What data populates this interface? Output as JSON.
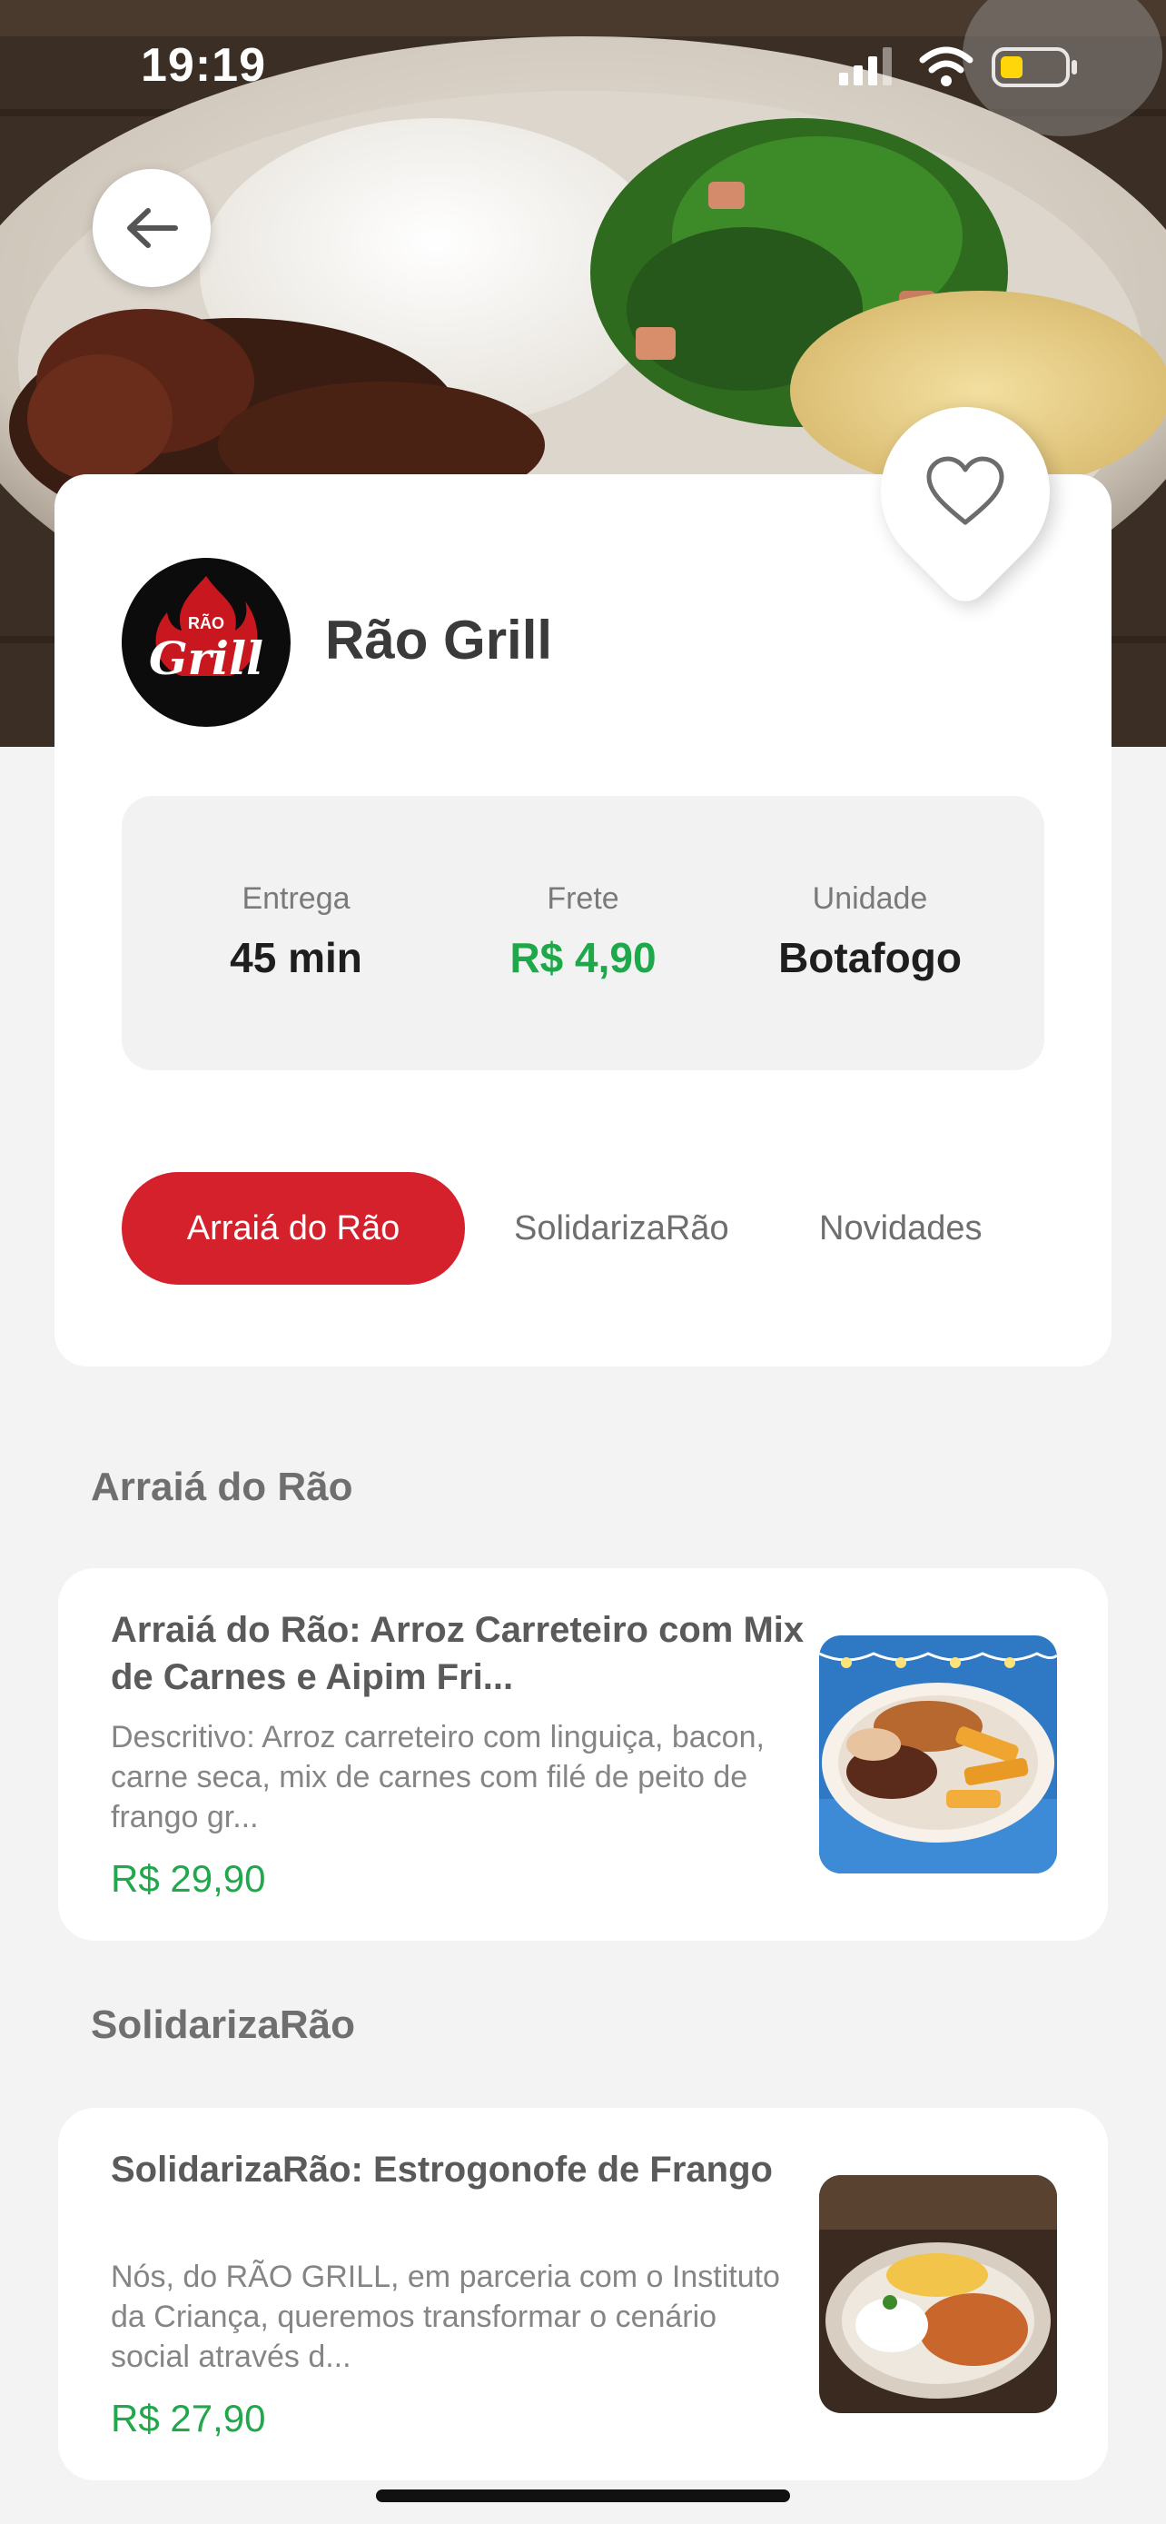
{
  "status_bar": {
    "time": "19:19"
  },
  "store": {
    "name": "Rão Grill",
    "logo_text_top": "RÃO",
    "logo_text_main": "Grill"
  },
  "info": {
    "delivery_label": "Entrega",
    "delivery_value": "45 min",
    "fee_label": "Frete",
    "fee_value": "R$ 4,90",
    "unit_label": "Unidade",
    "unit_value": "Botafogo"
  },
  "tabs": [
    {
      "label": "Arraiá do Rão",
      "active": true
    },
    {
      "label": "SolidarizaRão",
      "active": false
    },
    {
      "label": "Novidades",
      "active": false
    }
  ],
  "sections": [
    {
      "title": "Arraiá do Rão",
      "products": [
        {
          "name": "Arraiá do Rão: Arroz Carreteiro com Mix de Carnes e Aipim Fri...",
          "description": "Descritivo: Arroz carreteiro com linguiça, bacon, carne seca, mix de carnes com filé de peito de frango gr...",
          "price": "R$ 29,90"
        }
      ]
    },
    {
      "title": "SolidarizaRão",
      "products": [
        {
          "name": "SolidarizaRão: Estrogonofe de Frango",
          "description": "Nós, do RÃO GRILL, em parceria com o Instituto da Criança, queremos transformar o cenário social através d...",
          "price": "R$ 27,90"
        }
      ]
    }
  ],
  "colors": {
    "accent_red": "#d4212c",
    "price_green": "#1fa84a",
    "background": "#f4f3f3"
  },
  "icons": {
    "back": "arrow-left-icon",
    "favorite": "heart-outline-icon",
    "signal": "cellular-signal-icon",
    "wifi": "wifi-icon",
    "battery": "battery-low-icon"
  }
}
